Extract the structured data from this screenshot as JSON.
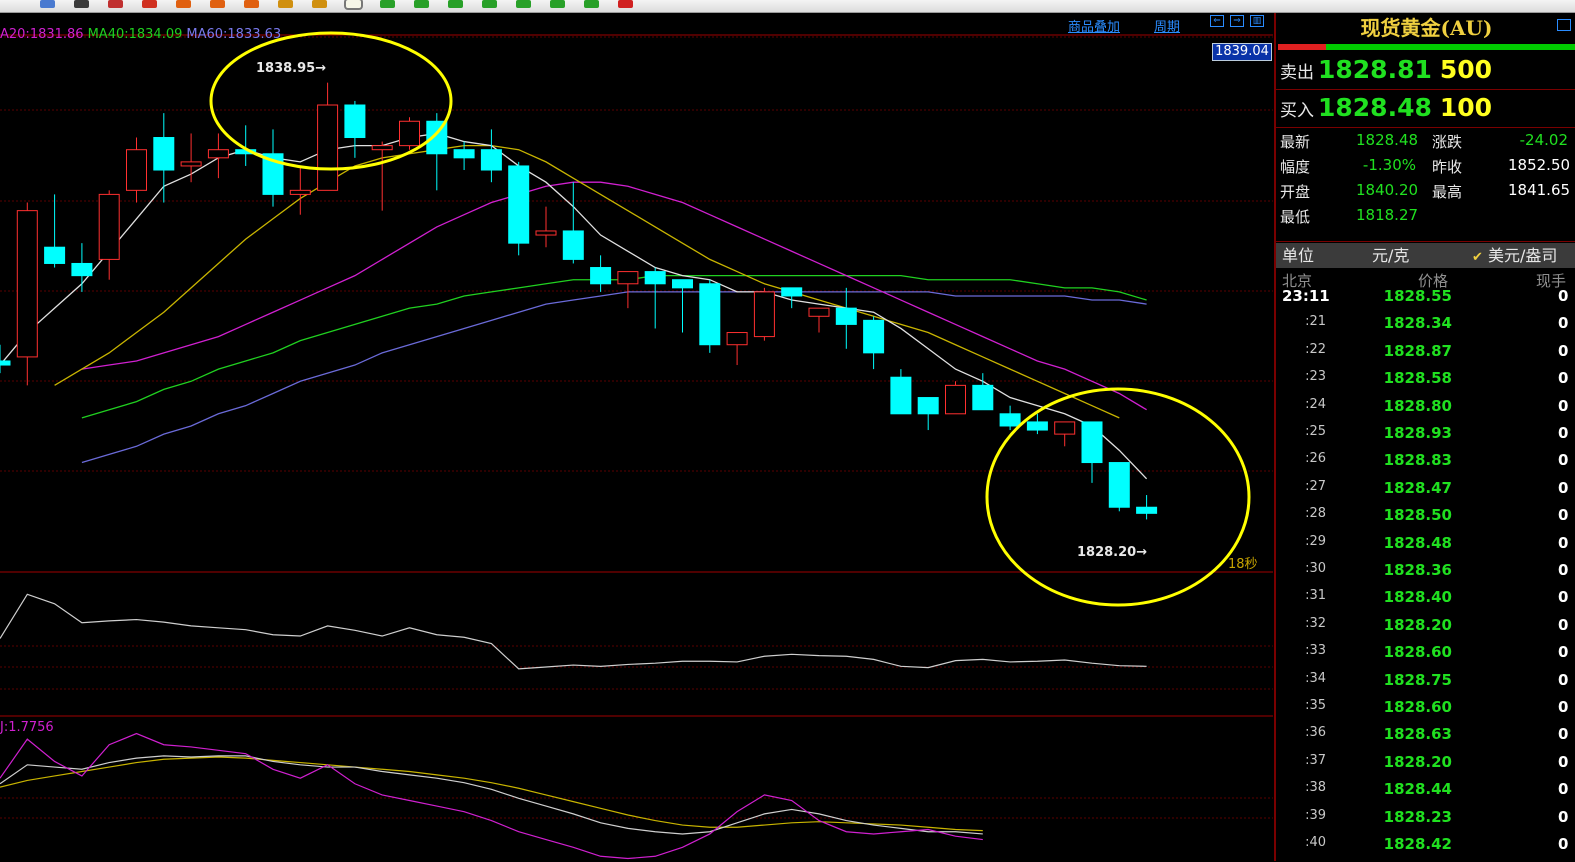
{
  "toolbar": {
    "buttons": [
      {
        "icon": "arrow-icon",
        "color": "#4a7ad0"
      },
      {
        "icon": "list-icon",
        "color": "#3a3a3a"
      },
      {
        "icon": "bars-icon",
        "color": "#c03030"
      },
      {
        "icon": "news-icon",
        "color": "#d03020"
      },
      {
        "icon": "day-icon",
        "color": "#e06010"
      },
      {
        "icon": "week-icon",
        "color": "#e06010"
      },
      {
        "icon": "month-icon",
        "color": "#e06010"
      },
      {
        "icon": "season-icon",
        "color": "#d09010"
      },
      {
        "icon": "year-icon",
        "color": "#d09010"
      },
      {
        "icon": "min1-icon",
        "color": "#28a028",
        "active": true
      },
      {
        "icon": "min5-icon",
        "color": "#28a028"
      },
      {
        "icon": "min15-icon",
        "color": "#28a028"
      },
      {
        "icon": "min30-icon",
        "color": "#28a028"
      },
      {
        "icon": "min60-icon",
        "color": "#28a028"
      },
      {
        "icon": "multi-icon",
        "color": "#28a028"
      },
      {
        "icon": "ticks-icon",
        "color": "#28a028"
      },
      {
        "icon": "ruler-icon",
        "color": "#28a028"
      },
      {
        "icon": "calc-icon",
        "color": "#d02020"
      }
    ]
  },
  "chart": {
    "ma_legend": [
      {
        "text": "A20:1831.86",
        "color": "#d020d0"
      },
      {
        "text": "MA40:1834.09",
        "color": "#20d020"
      },
      {
        "text": "MA60:1833.63",
        "color": "#7a7aee"
      }
    ],
    "links": {
      "overlay": "商品叠加",
      "period": "周期"
    },
    "current_price_tag": "1839.04",
    "countdown": "18秒",
    "high_label": "1838.95",
    "low_label": "1828.20",
    "sub_indicator_label": "J:1.7756"
  },
  "colors": {
    "up": "#ff3030",
    "down": "#00ffff",
    "ma5": "#e0e0e0",
    "ma10": "#c8b400",
    "ma20": "#d020d0",
    "ma40": "#20d020",
    "ma60": "#6a6ad8",
    "circle": "#ffff00"
  },
  "chart_data": {
    "type": "candlestick",
    "title": "现货黄金(AU)",
    "xlabel": "",
    "ylabel": "",
    "ylim": [
      1827.3,
      1840.0
    ],
    "candles": [
      {
        "o": 1832.1,
        "h": 1832.5,
        "l": 1831.8,
        "c": 1832.0
      },
      {
        "o": 1832.2,
        "h": 1836.0,
        "l": 1831.5,
        "c": 1835.8
      },
      {
        "o": 1834.9,
        "h": 1836.2,
        "l": 1834.4,
        "c": 1834.5
      },
      {
        "o": 1834.5,
        "h": 1835.0,
        "l": 1833.8,
        "c": 1834.2
      },
      {
        "o": 1834.6,
        "h": 1836.3,
        "l": 1834.1,
        "c": 1836.2
      },
      {
        "o": 1836.3,
        "h": 1837.6,
        "l": 1836.0,
        "c": 1837.3
      },
      {
        "o": 1837.6,
        "h": 1838.2,
        "l": 1836.0,
        "c": 1836.8
      },
      {
        "o": 1836.9,
        "h": 1837.7,
        "l": 1836.5,
        "c": 1837.0
      },
      {
        "o": 1837.1,
        "h": 1837.7,
        "l": 1836.6,
        "c": 1837.3
      },
      {
        "o": 1837.3,
        "h": 1837.9,
        "l": 1836.9,
        "c": 1837.2
      },
      {
        "o": 1837.2,
        "h": 1837.8,
        "l": 1835.9,
        "c": 1836.2
      },
      {
        "o": 1836.2,
        "h": 1836.9,
        "l": 1835.7,
        "c": 1836.3
      },
      {
        "o": 1836.3,
        "h": 1838.95,
        "l": 1836.3,
        "c": 1838.4
      },
      {
        "o": 1838.4,
        "h": 1838.5,
        "l": 1837.1,
        "c": 1837.6
      },
      {
        "o": 1837.3,
        "h": 1837.5,
        "l": 1835.8,
        "c": 1837.4
      },
      {
        "o": 1837.4,
        "h": 1838.1,
        "l": 1837.3,
        "c": 1838.0
      },
      {
        "o": 1838.0,
        "h": 1838.2,
        "l": 1836.3,
        "c": 1837.2
      },
      {
        "o": 1837.3,
        "h": 1837.5,
        "l": 1836.8,
        "c": 1837.1
      },
      {
        "o": 1837.3,
        "h": 1837.8,
        "l": 1836.5,
        "c": 1836.8
      },
      {
        "o": 1836.9,
        "h": 1837.0,
        "l": 1834.7,
        "c": 1835.0
      },
      {
        "o": 1835.2,
        "h": 1835.9,
        "l": 1834.9,
        "c": 1835.3
      },
      {
        "o": 1835.3,
        "h": 1836.5,
        "l": 1834.5,
        "c": 1834.6
      },
      {
        "o": 1834.4,
        "h": 1834.7,
        "l": 1833.8,
        "c": 1834.0
      },
      {
        "o": 1834.0,
        "h": 1834.3,
        "l": 1833.4,
        "c": 1834.3
      },
      {
        "o": 1834.3,
        "h": 1834.4,
        "l": 1832.9,
        "c": 1834.0
      },
      {
        "o": 1834.1,
        "h": 1834.1,
        "l": 1832.8,
        "c": 1833.9
      },
      {
        "o": 1834.0,
        "h": 1834.1,
        "l": 1832.3,
        "c": 1832.5
      },
      {
        "o": 1832.5,
        "h": 1832.8,
        "l": 1832.0,
        "c": 1832.8
      },
      {
        "o": 1832.7,
        "h": 1833.9,
        "l": 1832.6,
        "c": 1833.8
      },
      {
        "o": 1833.9,
        "h": 1833.9,
        "l": 1833.4,
        "c": 1833.7
      },
      {
        "o": 1833.2,
        "h": 1833.4,
        "l": 1832.8,
        "c": 1833.4
      },
      {
        "o": 1833.4,
        "h": 1833.9,
        "l": 1832.4,
        "c": 1833.0
      },
      {
        "o": 1833.1,
        "h": 1833.2,
        "l": 1831.9,
        "c": 1832.3
      },
      {
        "o": 1831.7,
        "h": 1831.9,
        "l": 1830.8,
        "c": 1830.8
      },
      {
        "o": 1831.2,
        "h": 1831.2,
        "l": 1830.4,
        "c": 1830.8
      },
      {
        "o": 1830.8,
        "h": 1831.6,
        "l": 1830.8,
        "c": 1831.5
      },
      {
        "o": 1831.5,
        "h": 1831.8,
        "l": 1830.9,
        "c": 1830.9
      },
      {
        "o": 1830.8,
        "h": 1831.0,
        "l": 1830.4,
        "c": 1830.5
      },
      {
        "o": 1830.6,
        "h": 1830.8,
        "l": 1830.3,
        "c": 1830.4
      },
      {
        "o": 1830.3,
        "h": 1830.6,
        "l": 1830.0,
        "c": 1830.6
      },
      {
        "o": 1830.6,
        "h": 1830.6,
        "l": 1829.1,
        "c": 1829.6
      },
      {
        "o": 1829.6,
        "h": 1829.6,
        "l": 1828.4,
        "c": 1828.5
      },
      {
        "o": 1828.5,
        "h": 1828.8,
        "l": 1828.2,
        "c": 1828.35
      }
    ],
    "ma5": [
      1832.0,
      1832.8,
      1833.4,
      1834.0,
      1834.8,
      1835.6,
      1836.4,
      1836.7,
      1837.1,
      1837.3,
      1837.1,
      1837.0,
      1837.3,
      1837.4,
      1837.4,
      1837.6,
      1837.7,
      1837.5,
      1837.4,
      1836.9,
      1836.5,
      1835.9,
      1835.2,
      1834.8,
      1834.4,
      1834.2,
      1834.1,
      1833.8,
      1833.8,
      1833.6,
      1833.5,
      1833.4,
      1833.3,
      1832.9,
      1832.4,
      1831.9,
      1831.6,
      1831.2,
      1831.0,
      1830.8,
      1830.5,
      1829.9,
      1829.2
    ],
    "ma10": [
      1831.5,
      1831.9,
      1832.3,
      1832.8,
      1833.3,
      1833.9,
      1834.5,
      1835.1,
      1835.6,
      1836.1,
      1836.5,
      1836.9,
      1837.1,
      1837.2,
      1837.3,
      1837.4,
      1837.4,
      1837.3,
      1837.0,
      1836.6,
      1836.2,
      1835.8,
      1835.4,
      1835.0,
      1834.6,
      1834.3,
      1834.0,
      1833.8,
      1833.6,
      1833.4,
      1833.2,
      1833.0,
      1832.8,
      1832.5,
      1832.2,
      1831.9,
      1831.6,
      1831.3,
      1831.0,
      1830.7
    ],
    "ma20": [
      1831.9,
      1832.0,
      1832.1,
      1832.3,
      1832.5,
      1832.7,
      1833.0,
      1833.3,
      1833.6,
      1833.9,
      1834.2,
      1834.6,
      1835.0,
      1835.4,
      1835.7,
      1836.0,
      1836.2,
      1836.4,
      1836.5,
      1836.5,
      1836.4,
      1836.2,
      1836.0,
      1835.7,
      1835.4,
      1835.1,
      1834.8,
      1834.5,
      1834.2,
      1833.9,
      1833.6,
      1833.3,
      1833.0,
      1832.7,
      1832.4,
      1832.1,
      1831.9,
      1831.6,
      1831.3,
      1830.9
    ],
    "ma40": [
      1830.7,
      1830.9,
      1831.1,
      1831.4,
      1831.6,
      1831.9,
      1832.1,
      1832.3,
      1832.6,
      1832.8,
      1833.0,
      1833.2,
      1833.4,
      1833.5,
      1833.7,
      1833.8,
      1833.9,
      1834.0,
      1834.1,
      1834.1,
      1834.1,
      1834.2,
      1834.2,
      1834.2,
      1834.2,
      1834.2,
      1834.2,
      1834.2,
      1834.2,
      1834.2,
      1834.2,
      1834.1,
      1834.1,
      1834.1,
      1834.1,
      1834.0,
      1833.9,
      1833.9,
      1833.8,
      1833.6
    ],
    "ma60": [
      1829.6,
      1829.8,
      1830.0,
      1830.3,
      1830.5,
      1830.8,
      1831.0,
      1831.3,
      1831.6,
      1831.8,
      1832.0,
      1832.3,
      1832.5,
      1832.7,
      1832.9,
      1833.1,
      1833.3,
      1833.5,
      1833.6,
      1833.7,
      1833.8,
      1833.8,
      1833.8,
      1833.8,
      1833.8,
      1833.8,
      1833.8,
      1833.8,
      1833.8,
      1833.8,
      1833.8,
      1833.8,
      1833.7,
      1833.7,
      1833.7,
      1833.7,
      1833.7,
      1833.6,
      1833.6,
      1833.5
    ],
    "osc1": [
      0.2,
      0.9,
      0.75,
      0.45,
      0.48,
      0.5,
      0.46,
      0.4,
      0.37,
      0.34,
      0.26,
      0.24,
      0.4,
      0.33,
      0.24,
      0.37,
      0.26,
      0.22,
      0.12,
      -0.28,
      -0.25,
      -0.22,
      -0.24,
      -0.21,
      -0.19,
      -0.16,
      -0.16,
      -0.17,
      -0.08,
      -0.05,
      -0.07,
      -0.08,
      -0.13,
      -0.24,
      -0.26,
      -0.15,
      -0.13,
      -0.17,
      -0.16,
      -0.14,
      -0.19,
      -0.23,
      -0.24
    ],
    "osc2_k": [
      0.55,
      0.72,
      0.7,
      0.68,
      0.74,
      0.78,
      0.8,
      0.79,
      0.8,
      0.8,
      0.75,
      0.72,
      0.7,
      0.7,
      0.66,
      0.63,
      0.6,
      0.56,
      0.5,
      0.42,
      0.35,
      0.28,
      0.2,
      0.15,
      0.12,
      0.1,
      0.12,
      0.2,
      0.28,
      0.32,
      0.28,
      0.22,
      0.18,
      0.15,
      0.12,
      0.12,
      0.1
    ],
    "osc2_d": [
      0.52,
      0.58,
      0.62,
      0.66,
      0.7,
      0.74,
      0.77,
      0.78,
      0.79,
      0.78,
      0.76,
      0.74,
      0.72,
      0.7,
      0.68,
      0.66,
      0.63,
      0.6,
      0.56,
      0.51,
      0.45,
      0.39,
      0.33,
      0.27,
      0.22,
      0.18,
      0.16,
      0.16,
      0.18,
      0.2,
      0.21,
      0.2,
      0.19,
      0.18,
      0.16,
      0.14,
      0.13
    ],
    "osc2_j": [
      0.6,
      0.95,
      0.75,
      0.62,
      0.9,
      1.0,
      0.9,
      0.88,
      0.85,
      0.82,
      0.68,
      0.6,
      0.72,
      0.55,
      0.45,
      0.4,
      0.35,
      0.3,
      0.22,
      0.12,
      0.05,
      -0.02,
      -0.1,
      -0.12,
      -0.1,
      -0.02,
      0.1,
      0.3,
      0.45,
      0.4,
      0.22,
      0.12,
      0.1,
      0.12,
      0.14,
      0.08,
      0.05
    ]
  },
  "panel": {
    "title": "现货黄金(AU)",
    "sell_label": "卖出",
    "sell_price": "1828.81",
    "sell_vol": "500",
    "buy_label": "买入",
    "buy_price": "1828.48",
    "buy_vol": "100",
    "stats": [
      {
        "label": "最新",
        "value": "1828.48",
        "label2": "涨跌",
        "value2": "-24.02"
      },
      {
        "label": "幅度",
        "value": "-1.30%",
        "label2": "昨收",
        "value2": "1852.50"
      },
      {
        "label": "开盘",
        "value": "1840.20",
        "label2": "最高",
        "value2": "1841.65"
      },
      {
        "label": "最低",
        "value": "1818.27",
        "label2": "",
        "value2": ""
      }
    ],
    "unit_label": "单位",
    "unit_value": "元/克",
    "unit_alt": "美元/盎司",
    "headers": {
      "time": "北京",
      "price": "价格",
      "qty": "现手"
    },
    "ticks": [
      {
        "time": "23:11",
        "price": "1828.55",
        "qty": "0"
      },
      {
        "time": ":21",
        "price": "1828.34",
        "qty": "0"
      },
      {
        "time": ":22",
        "price": "1828.87",
        "qty": "0"
      },
      {
        "time": ":23",
        "price": "1828.58",
        "qty": "0"
      },
      {
        "time": ":24",
        "price": "1828.80",
        "qty": "0"
      },
      {
        "time": ":25",
        "price": "1828.93",
        "qty": "0"
      },
      {
        "time": ":26",
        "price": "1828.83",
        "qty": "0"
      },
      {
        "time": ":27",
        "price": "1828.47",
        "qty": "0"
      },
      {
        "time": ":28",
        "price": "1828.50",
        "qty": "0"
      },
      {
        "time": ":29",
        "price": "1828.48",
        "qty": "0"
      },
      {
        "time": ":30",
        "price": "1828.36",
        "qty": "0"
      },
      {
        "time": ":31",
        "price": "1828.40",
        "qty": "0"
      },
      {
        "time": ":32",
        "price": "1828.20",
        "qty": "0"
      },
      {
        "time": ":33",
        "price": "1828.60",
        "qty": "0"
      },
      {
        "time": ":34",
        "price": "1828.75",
        "qty": "0"
      },
      {
        "time": ":35",
        "price": "1828.60",
        "qty": "0"
      },
      {
        "time": ":36",
        "price": "1828.63",
        "qty": "0"
      },
      {
        "time": ":37",
        "price": "1828.20",
        "qty": "0"
      },
      {
        "time": ":38",
        "price": "1828.44",
        "qty": "0"
      },
      {
        "time": ":39",
        "price": "1828.23",
        "qty": "0"
      },
      {
        "time": ":40",
        "price": "1828.42",
        "qty": "0"
      }
    ]
  }
}
